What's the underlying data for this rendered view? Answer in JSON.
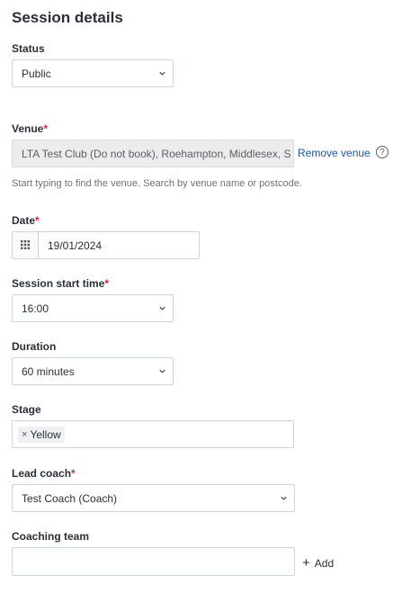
{
  "page": {
    "title": "Session details"
  },
  "status": {
    "label": "Status",
    "value": "Public"
  },
  "venue": {
    "label": "Venue",
    "required_mark": "*",
    "value": "LTA Test Club (Do not book), Roehampton, Middlesex, S",
    "remove_label": "Remove venue",
    "help_icon_text": "?",
    "hint": "Start typing to find the venue. Search by venue name or postcode."
  },
  "date": {
    "label": "Date",
    "required_mark": "*",
    "value": "19/01/2024"
  },
  "start_time": {
    "label": "Session start time",
    "required_mark": "*",
    "value": "16:00"
  },
  "duration": {
    "label": "Duration",
    "value": "60 minutes"
  },
  "stage": {
    "label": "Stage",
    "tags": [
      {
        "remove": "×",
        "text": "Yellow"
      }
    ]
  },
  "lead_coach": {
    "label": "Lead coach",
    "required_mark": "*",
    "value": "Test Coach (Coach)"
  },
  "coaching_team": {
    "label": "Coaching team",
    "add_icon": "+",
    "add_label": "Add",
    "value": ""
  },
  "icons": {
    "chevron": "chevron-down-icon",
    "calendar": "calendar-grid-icon",
    "help": "help-circle-icon",
    "plus": "plus-icon"
  }
}
